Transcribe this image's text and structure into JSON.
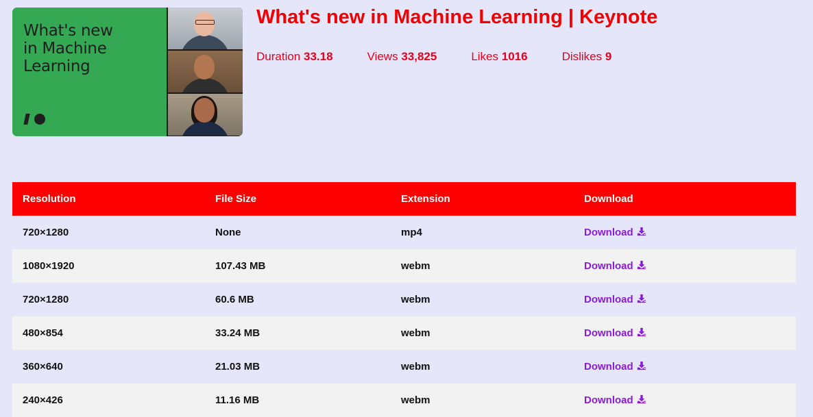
{
  "video": {
    "thumbnail_text": "What's new\nin Machine\nLearning",
    "logo_text": "I/O",
    "title": "What's new in Machine Learning | Keynote",
    "stats": [
      {
        "label": "Duration",
        "value": "33.18"
      },
      {
        "label": "Views",
        "value": "33,825"
      },
      {
        "label": "Likes",
        "value": "1016"
      },
      {
        "label": "Dislikes",
        "value": "9"
      }
    ]
  },
  "table": {
    "headers": [
      "Resolution",
      "File Size",
      "Extension",
      "Download"
    ],
    "rows": [
      {
        "resolution": "720×1280",
        "size": "None",
        "ext": "mp4",
        "download": "Download"
      },
      {
        "resolution": "1080×1920",
        "size": "107.43 MB",
        "ext": "webm",
        "download": "Download"
      },
      {
        "resolution": "720×1280",
        "size": "60.6 MB",
        "ext": "webm",
        "download": "Download"
      },
      {
        "resolution": "480×854",
        "size": "33.24 MB",
        "ext": "webm",
        "download": "Download"
      },
      {
        "resolution": "360×640",
        "size": "21.03 MB",
        "ext": "webm",
        "download": "Download"
      },
      {
        "resolution": "240×426",
        "size": "11.16 MB",
        "ext": "webm",
        "download": "Download"
      }
    ],
    "download_icon": "download-icon"
  },
  "colors": {
    "background": "#e6e6fa",
    "accent_red": "#ff0000",
    "title_red": "#f00000",
    "link_purple": "#8a1cd8",
    "thumb_green": "#34a853"
  }
}
